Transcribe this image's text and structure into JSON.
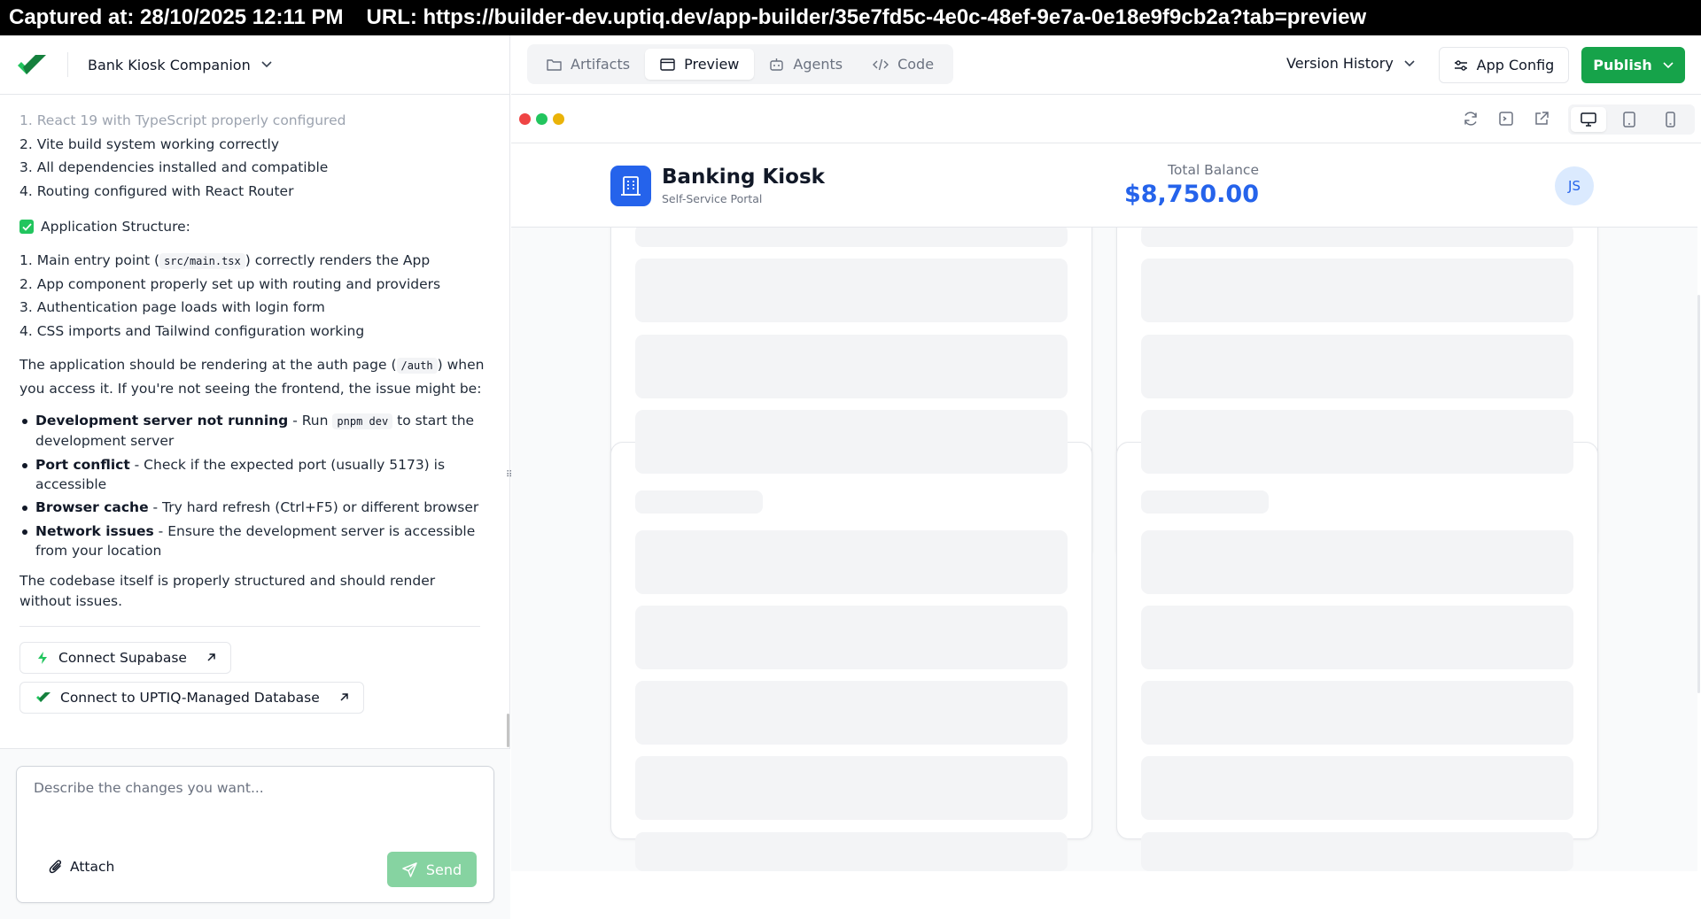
{
  "capture": {
    "captured_at": "Captured at: 28/10/2025 12:11 PM",
    "url": "URL: https://builder-dev.uptiq.dev/app-builder/35e7fd5c-4e0c-48ef-9e7a-0e18e9f9cb2a?tab=preview"
  },
  "project": {
    "name": "Bank Kiosk Companion"
  },
  "chat": {
    "list1": [
      "1. React 19 with TypeScript properly configured",
      "2. Vite build system working correctly",
      "3. All dependencies installed and compatible",
      "4. Routing configured with React Router"
    ],
    "app_structure_heading": "Application Structure:",
    "list2": {
      "item1_pre": "1. Main entry point (",
      "item1_code": "src/main.tsx",
      "item1_post": ") correctly renders the App",
      "item2": "2. App component properly set up with routing and providers",
      "item3": "3. Authentication page loads with login form",
      "item4": "4. CSS imports and Tailwind configuration working"
    },
    "para1_pre": "The application should be rendering at the auth page (",
    "para1_code": "/auth",
    "para1_post": ") when you access it. If you're not seeing the frontend, the issue might be:",
    "bullets": {
      "b1_bold": "Development server not running",
      "b1_pre": " - Run ",
      "b1_code": "pnpm dev",
      "b1_post": " to start the development server",
      "b2_bold": "Port conflict",
      "b2_text": " - Check if the expected port (usually 5173) is accessible",
      "b3_bold": "Browser cache",
      "b3_text": " - Try hard refresh (Ctrl+F5) or different browser",
      "b4_bold": "Network issues",
      "b4_text": " - Ensure the development server is accessible from your location"
    },
    "final_para": "The codebase itself is properly structured and should render without issues.",
    "connect_supabase": "Connect Supabase",
    "connect_uptiq": "Connect to UPTIQ-Managed Database"
  },
  "composer": {
    "placeholder": "Describe the changes you want...",
    "attach": "Attach",
    "send": "Send"
  },
  "tabs": [
    {
      "label": "Artifacts",
      "icon": "folder-icon"
    },
    {
      "label": "Preview",
      "icon": "browser-window-icon"
    },
    {
      "label": "Agents",
      "icon": "robot-icon"
    },
    {
      "label": "Code",
      "icon": "code-icon"
    }
  ],
  "active_tab": "Preview",
  "toolbar": {
    "version_history": "Version History",
    "app_config": "App Config",
    "publish": "Publish"
  },
  "preview_toolbar": {
    "window_dots": [
      "#ef4444",
      "#22c55e",
      "#eab308"
    ],
    "actions": [
      "refresh-icon",
      "terminal-icon",
      "external-link-icon"
    ],
    "devices": [
      "desktop-icon",
      "tablet-icon",
      "mobile-icon"
    ],
    "active_device": "desktop"
  },
  "kiosk": {
    "title": "Banking Kiosk",
    "subtitle": "Self-Service Portal",
    "balance_label": "Total Balance",
    "balance_value": "$8,750.00",
    "avatar_initials": "JS"
  },
  "colors": {
    "brand_green": "#16a34a",
    "kiosk_blue": "#2563eb",
    "skeleton": "#f3f4f6"
  }
}
